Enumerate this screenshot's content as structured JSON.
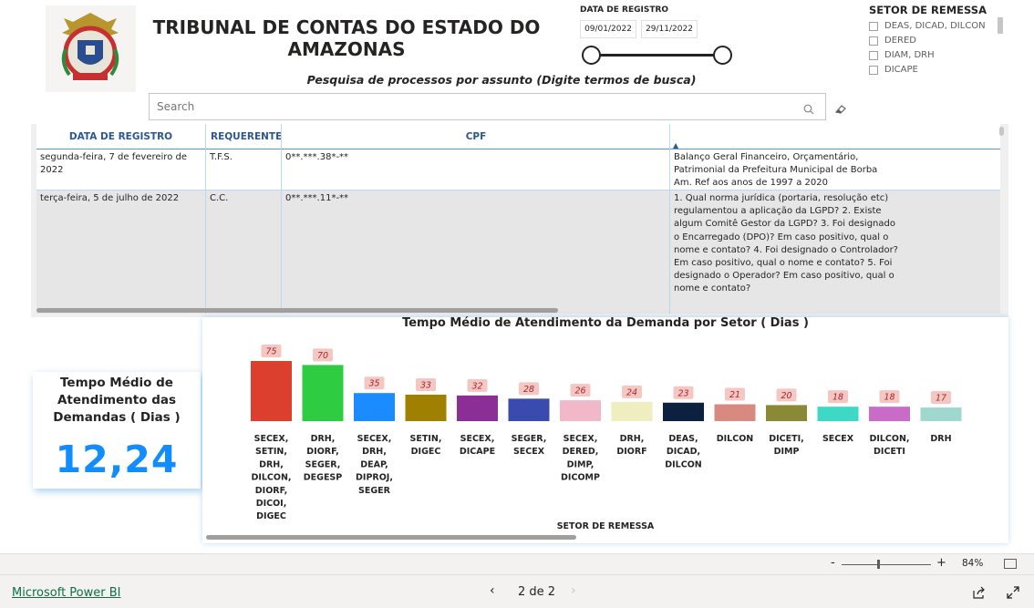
{
  "header": {
    "title": "TRIBUNAL DE CONTAS DO ESTADO DO AMAZONAS",
    "subtitle": "Pesquisa de processos por assunto (Digite termos de busca)",
    "logo_icon": "tce-am-coat-of-arms-logo"
  },
  "search": {
    "placeholder": "Search",
    "value": "",
    "search_icon": "search-icon",
    "clear_icon": "eraser-icon"
  },
  "date_slicer": {
    "label": "DATA DE REGISTRO",
    "start": "09/01/2022",
    "end": "29/11/2022"
  },
  "setor_slicer": {
    "label": "SETOR DE REMESSA",
    "options": [
      "DEAS, DICAD, DILCON",
      "DERED",
      "DIAM, DRH",
      "DICAPE"
    ]
  },
  "table": {
    "columns": [
      "DATA DE REGISTRO",
      "REQUERENTE",
      "CPF",
      "▲"
    ],
    "rows": [
      {
        "data": "segunda-feira, 7 de fevereiro de 2022",
        "requerente": "T.F.S.",
        "cpf": "0**.***.38*-**",
        "assunto": "Balanço Geral Financeiro, Orçamentário, Patrimonial da Prefeitura Municipal de Borba Am. Ref aos anos de 1997 a 2020"
      },
      {
        "data": "terça-feira, 5 de julho de 2022",
        "requerente": "C.C.",
        "cpf": "0**.***.11*-**",
        "assunto": "1. Qual norma jurídica (portaria, resolução etc) regulamentou a aplicação da LGPD? 2. Existe algum Comitê Gestor da LGPD? 3. Foi designado o Encarregado (DPO)? Em caso positivo, qual o nome e contato? 4. Foi designado o Controlador? Em caso positivo, qual o nome e contato? 5. Foi designado o Operador? Em caso positivo, qual o nome e contato?"
      }
    ]
  },
  "kpi": {
    "title": "Tempo Médio de Atendimento das Demandas ( Dias )",
    "value": "12,24"
  },
  "chart_data": {
    "type": "bar",
    "title": "Tempo Médio de Atendimento da Demanda por Setor ( Dias )",
    "xlabel": "SETOR DE REMESSA",
    "ylabel": "",
    "ylim": [
      0,
      75
    ],
    "categories": [
      "SECEX, SETIN, DRH, DILCON, DIORF, DICOI, DIGEC",
      "DRH, DIORF, SEGER, DEGESP",
      "SECEX, DRH, DEAP, DIPROJ, SEGER",
      "SETIN, DIGEC",
      "SECEX, DICAPE",
      "SEGER, SECEX",
      "SECEX, DERED, DIMP, DICOMP",
      "DRH, DIORF",
      "DEAS, DICAD, DILCON",
      "DILCON",
      "DICETI, DIMP",
      "SECEX",
      "DILCON, DICETI",
      "DRH"
    ],
    "values": [
      75,
      70,
      35,
      33,
      32,
      28,
      26,
      24,
      23,
      21,
      20,
      18,
      18,
      17
    ],
    "colors": [
      "#dc3f2e",
      "#2ecc40",
      "#1a8cff",
      "#a08000",
      "#8b2f97",
      "#3a4bb0",
      "#f0b8c8",
      "#eeeec0",
      "#0c2040",
      "#d88a80",
      "#8a8a36",
      "#3dd9c4",
      "#c86cc8",
      "#a0d8d0"
    ],
    "label_bg": "#f4c7c3",
    "label_color": "#a4262c",
    "grid": false
  },
  "zoom": {
    "minus": "-",
    "plus": "+",
    "level": "84%"
  },
  "footer": {
    "brand": "Microsoft Power BI",
    "page": "2 de 2",
    "prev": "‹",
    "next": "›"
  }
}
